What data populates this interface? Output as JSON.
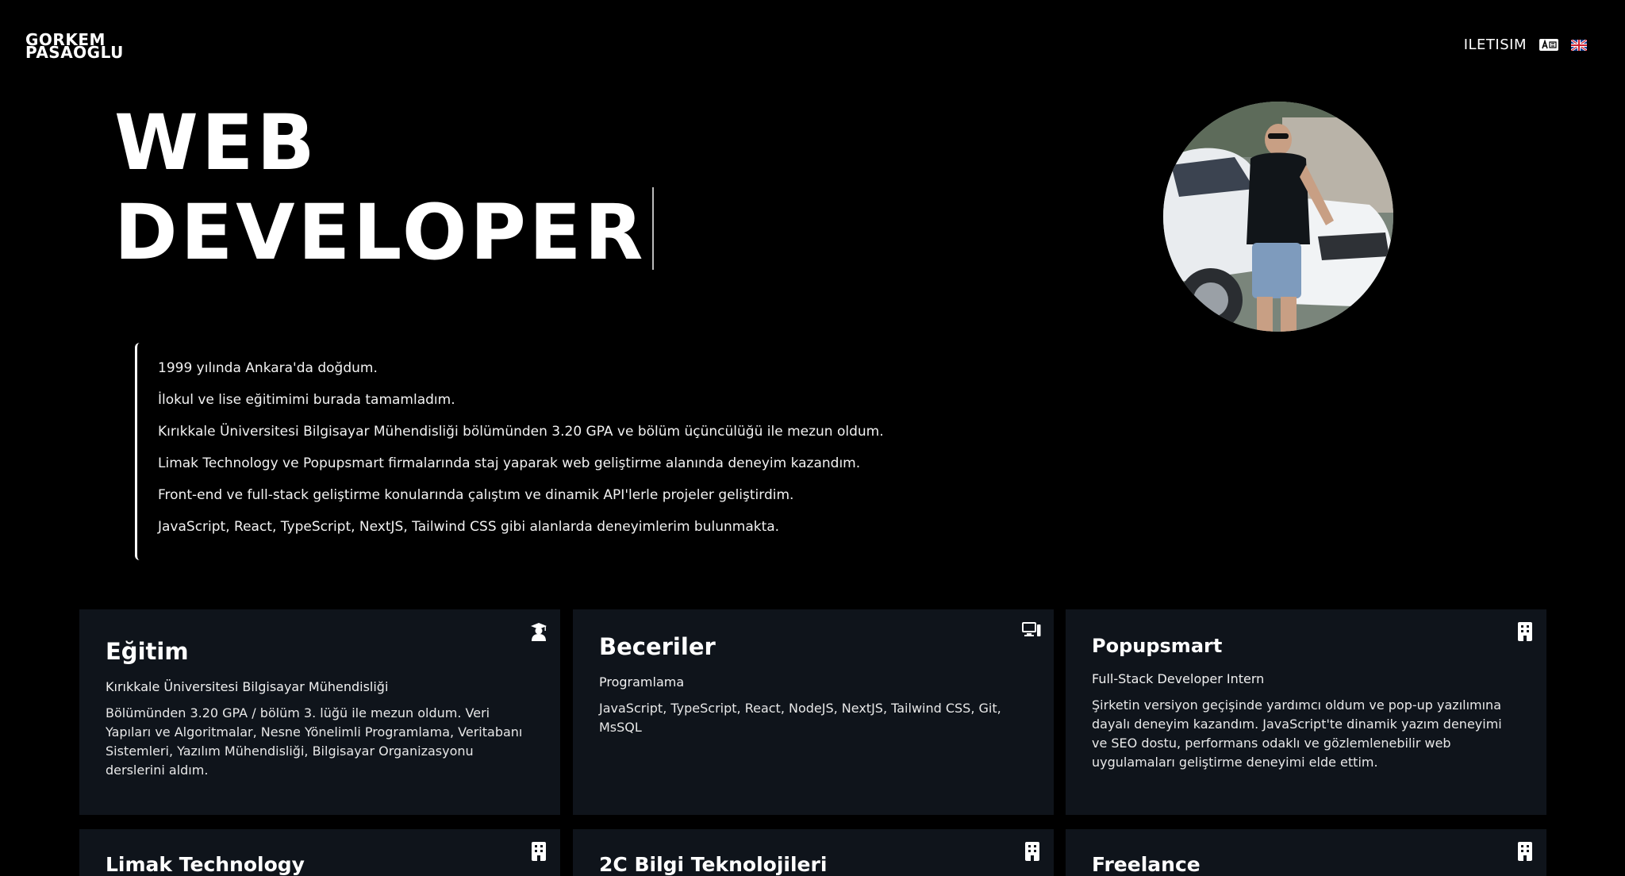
{
  "brand": {
    "line1": "GORKEM",
    "line2": "PASAOGLU"
  },
  "nav": {
    "contact_label": "ILETISIM",
    "icons": [
      "translate-icon",
      "uk-flag-icon"
    ]
  },
  "hero": {
    "line1": "WEB",
    "line2": "DEVELOPER"
  },
  "bio": [
    "1999 yılında Ankara'da doğdum.",
    "İlokul ve lise eğitimimi burada tamamladım.",
    "Kırıkkale Üniversitesi Bilgisayar Mühendisliği bölümünden 3.20 GPA ve bölüm üçüncülüğü ile mezun oldum.",
    "Limak Technology ve Popupsmart firmalarında staj yaparak web geliştirme alanında deneyim kazandım.",
    "Front-end ve full-stack geliştirme konularında çalıştım ve dinamik API'lerle projeler geliştirdim.",
    "JavaScript, React, TypeScript, NextJS, Tailwind CSS gibi alanlarda deneyimlerim bulunmakta."
  ],
  "cards": [
    {
      "title": "Eğitim",
      "subtitle": "Kırıkkale Üniversitesi Bilgisayar Mühendisliği",
      "description": "Bölümünden 3.20 GPA / bölüm 3. lüğü ile mezun oldum. Veri Yapıları ve Algoritmalar, Nesne Yönelimli Programlama, Veritabanı Sistemleri, Yazılım Mühendisliği, Bilgisayar Organizasyonu derslerini aldım.",
      "icon": "graduate-icon"
    },
    {
      "title": "Beceriler",
      "subtitle": "Programlama",
      "description": "JavaScript, TypeScript, React, NodeJS, NextJS, Tailwind CSS, Git, MsSQL",
      "icon": "computer-icon"
    },
    {
      "title": "Popupsmart",
      "subtitle": "Full-Stack Developer Intern",
      "description": "Şirketin versiyon geçişinde yardımcı oldum ve pop-up yazılımına dayalı deneyim kazandım. JavaScript'te dinamik yazım deneyimi ve SEO dostu, performans odaklı ve gözlemlenebilir web uygulamaları geliştirme deneyimi elde ettim.",
      "icon": "building-icon"
    },
    {
      "title": "Limak Technology",
      "icon": "building-icon"
    },
    {
      "title": "2C Bilgi Teknolojileri",
      "icon": "building-icon"
    },
    {
      "title": "Freelance",
      "icon": "building-icon"
    }
  ]
}
